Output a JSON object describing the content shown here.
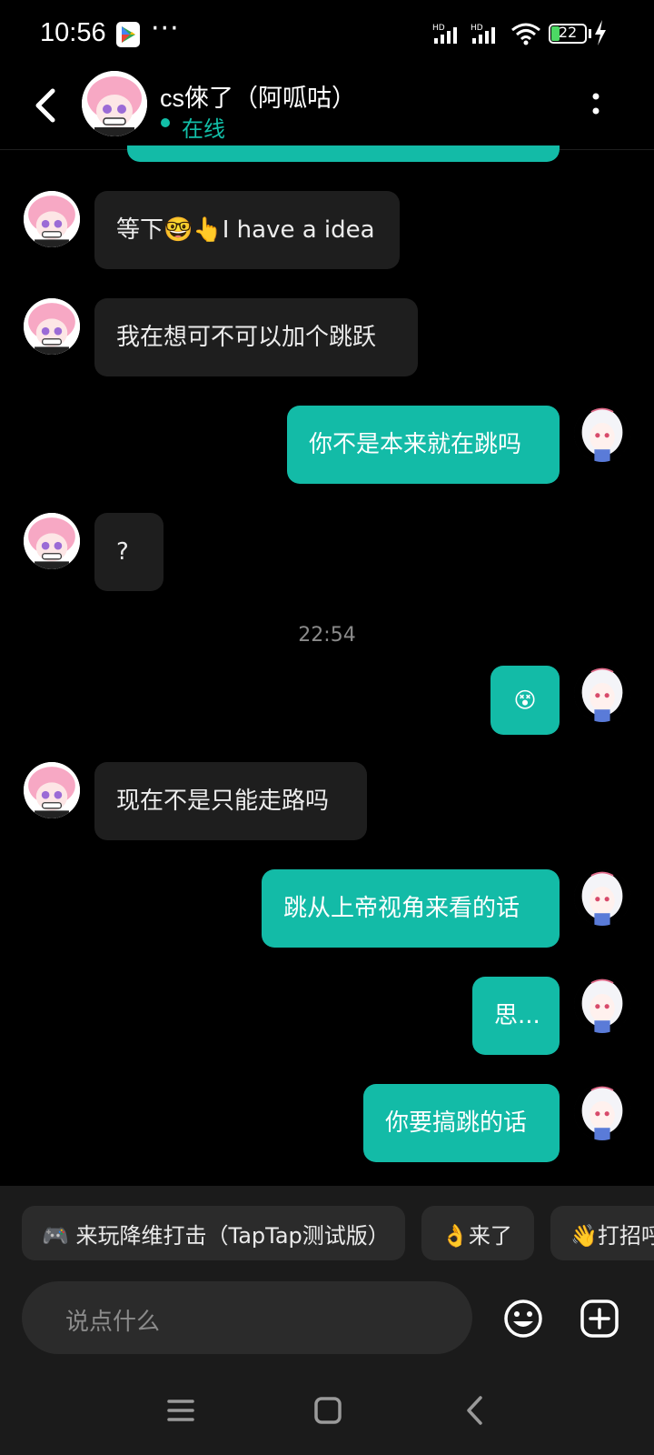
{
  "status_bar": {
    "time": "10:56",
    "more": "···",
    "battery": "22"
  },
  "header": {
    "title": "cs倈了（阿呱咕）",
    "status": "在线"
  },
  "messages": [
    {
      "side": "in",
      "text": "等下🤓👆I have a idea"
    },
    {
      "side": "in",
      "text": "我在想可不可以加个跳跃"
    },
    {
      "side": "out",
      "text": "你不是本来就在跳吗"
    },
    {
      "side": "in",
      "text": "?"
    },
    {
      "side": "out",
      "text": "😵"
    },
    {
      "side": "in",
      "text": "现在不是只能走路吗"
    },
    {
      "side": "out",
      "text": "跳从上帝视角来看的话"
    },
    {
      "side": "out",
      "text": "思..."
    },
    {
      "side": "out",
      "text": "你要搞跳的话"
    }
  ],
  "timestamp": "22:54",
  "quick_replies": [
    {
      "icon": "game-controller-icon",
      "text": "🎮 来玩降维打击（TapTap测试版）"
    },
    {
      "icon": "ok-hand-icon",
      "text": "👌来了"
    },
    {
      "icon": "wave-icon",
      "text": "👋打招呼"
    }
  ],
  "input": {
    "placeholder": "说点什么"
  },
  "colors": {
    "accent": "#13bba7",
    "incoming_bubble": "#1e1e1e",
    "background": "#000000"
  }
}
